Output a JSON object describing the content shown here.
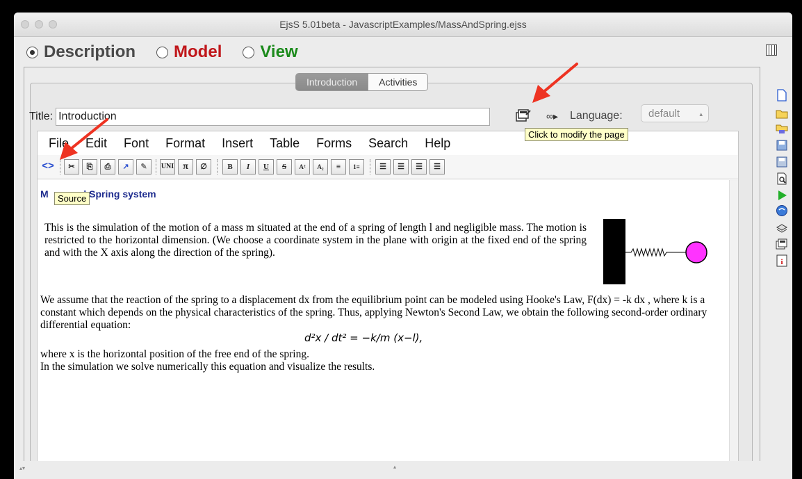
{
  "window": {
    "title": "EjsS 5.01beta - JavascriptExamples/MassAndSpring.ejss"
  },
  "modes": [
    {
      "label": "Description",
      "color": "#4a4a4a",
      "selected": true
    },
    {
      "label": "Model",
      "color": "#c0161a",
      "selected": false
    },
    {
      "label": "View",
      "color": "#1b8a1b",
      "selected": false
    }
  ],
  "tabs": {
    "introduction": "Introduction",
    "activities": "Activities"
  },
  "page": {
    "title_label": "Title:",
    "title_value": "Introduction",
    "language_label": "Language:",
    "language_value": "default",
    "modify_tooltip": "Click to modify the page"
  },
  "menu": [
    "File",
    "Edit",
    "Font",
    "Format",
    "Insert",
    "Table",
    "Forms",
    "Search",
    "Help"
  ],
  "toolbar": {
    "source_tooltip": "Source",
    "bold": "B",
    "italic": "I",
    "underline": "U",
    "strike": "S",
    "superscript": "A²",
    "subscript": "A₂",
    "pi": "π",
    "unicode": "UNI"
  },
  "doc": {
    "heading_prefix": "M",
    "heading_suffix": "d Spring system",
    "para1": "This is the simulation of the motion of a mass m situated at the end of a spring of length l and negligible mass. The motion is restricted to the horizontal dimension. (We choose a coordinate system in the plane with origin at the fixed end of the spring and with the X axis along the direction of the spring).",
    "para2": "We assume that the reaction of the spring to a displacement dx from the equilibrium point can be modeled using Hooke's Law, F(dx) = -k dx , where k is a constant which depends on the physical characteristics of the spring. Thus, applying Newton's Second Law, we obtain the following second-order ordinary differential equation:",
    "equation": "d²x / dt² = −k/m (x−l),",
    "para3": "where x is the horizontal position of the free end of the spring.",
    "para4": "In the simulation we solve numerically this equation and visualize the results."
  },
  "colors": {
    "heading": "#1f2d8f",
    "mass": "#ff33ff",
    "arrow": "#ee3322"
  },
  "icons": [
    "new-file-icon",
    "open-folder-icon",
    "open-remote-icon",
    "save-icon",
    "save-as-icon",
    "search-doc-icon",
    "run-icon",
    "browser-icon",
    "package-icon",
    "modify-page-icon",
    "info-icon"
  ]
}
